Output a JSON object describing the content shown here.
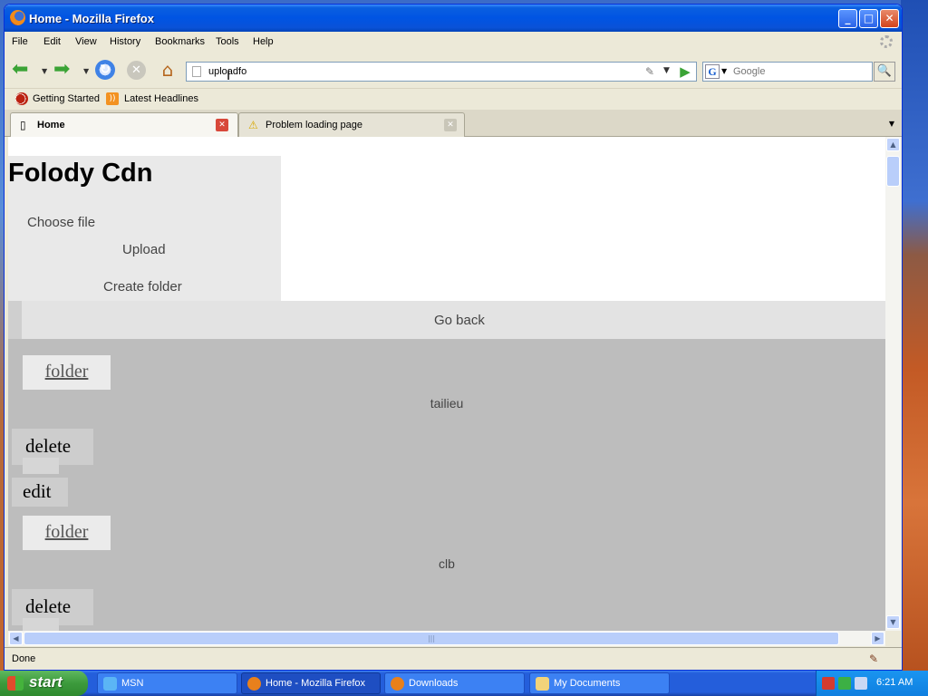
{
  "window": {
    "title": "Home - Mozilla Firefox",
    "controls": {
      "minimize": "_",
      "maximize": "□",
      "close": "✕"
    }
  },
  "menu": [
    "File",
    "Edit",
    "View",
    "History",
    "Bookmarks",
    "Tools",
    "Help"
  ],
  "navbar": {
    "url": "uploadfo",
    "search_placeholder": "Google"
  },
  "bookmarks": [
    "Getting Started",
    "Latest Headlines"
  ],
  "tabs": [
    {
      "label": "Home",
      "active": true
    },
    {
      "label": "Problem loading page",
      "active": false,
      "icon": "warning-icon"
    }
  ],
  "page": {
    "title": "Folody Cdn",
    "choose_file": "Choose file",
    "upload": "Upload",
    "create_folder": "Create folder",
    "go_back": "Go back",
    "items": [
      {
        "link": "folder",
        "name": "tailieu",
        "delete": "delete",
        "edit": "edit"
      },
      {
        "link": "folder",
        "name": "clb",
        "delete": "delete"
      }
    ]
  },
  "status": {
    "text": "Done"
  },
  "taskbar": {
    "start": "start",
    "tasks": [
      {
        "label": "MSN",
        "active": false
      },
      {
        "label": "Home - Mozilla Firefox",
        "active": true
      },
      {
        "label": "Downloads",
        "active": false
      },
      {
        "label": "My Documents",
        "active": false
      }
    ],
    "clock": "6:21 AM"
  }
}
